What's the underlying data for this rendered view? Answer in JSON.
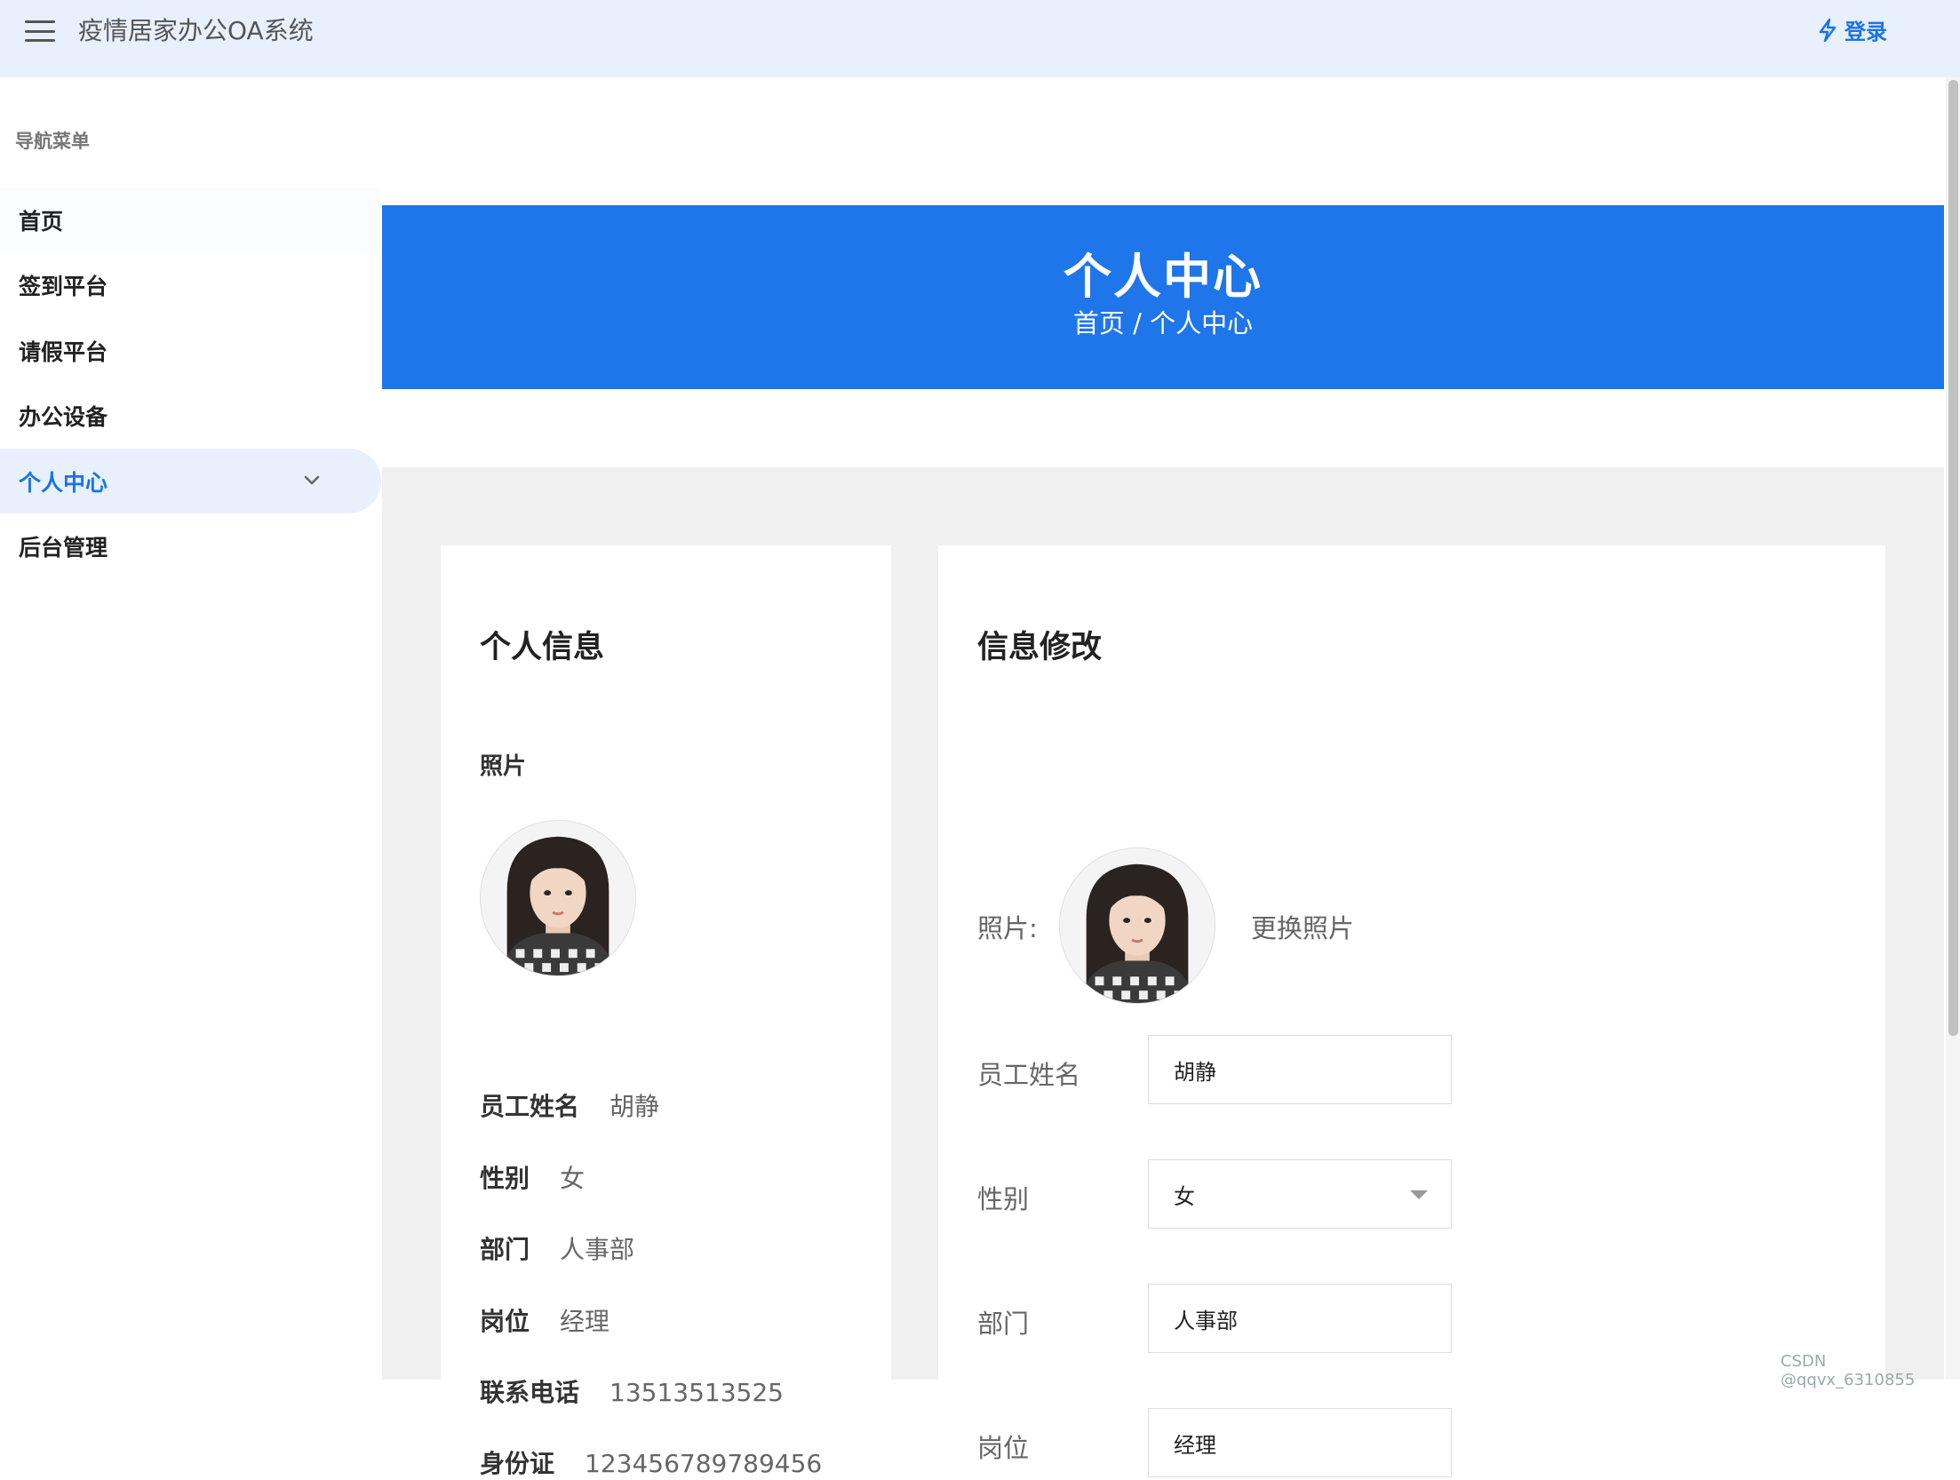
{
  "header": {
    "title": "疫情居家办公OA系统",
    "login_label": "登录"
  },
  "sidebar": {
    "caption": "导航菜单",
    "items": [
      {
        "label": "首页"
      },
      {
        "label": "签到平台"
      },
      {
        "label": "请假平台"
      },
      {
        "label": "办公设备"
      },
      {
        "label": "个人中心"
      },
      {
        "label": "后台管理"
      }
    ],
    "active_index": 4
  },
  "banner": {
    "title": "个人中心",
    "breadcrumb": "首页 / 个人中心"
  },
  "profile": {
    "title": "个人信息",
    "photo_label": "照片",
    "fields": [
      {
        "key": "员工姓名",
        "value": "胡静"
      },
      {
        "key": "性别",
        "value": "女"
      },
      {
        "key": "部门",
        "value": "人事部"
      },
      {
        "key": "岗位",
        "value": "经理"
      },
      {
        "key": "联系电话",
        "value": "13513513525"
      },
      {
        "key": "身份证",
        "value": "123456789789456"
      }
    ]
  },
  "edit": {
    "title": "信息修改",
    "photo_label": "照片:",
    "change_photo": "更换照片",
    "name_label": "员工姓名",
    "name_value": "胡静",
    "gender_label": "性别",
    "gender_value": "女",
    "dept_label": "部门",
    "dept_value": "人事部",
    "post_label": "岗位",
    "post_value": "经理"
  },
  "watermark": "CSDN @qqvx_6310855",
  "colors": {
    "primary": "#1f75ea",
    "link": "#1a73e8",
    "topbar_bg": "#e8f0fd",
    "content_bg": "#f0f0f0"
  }
}
